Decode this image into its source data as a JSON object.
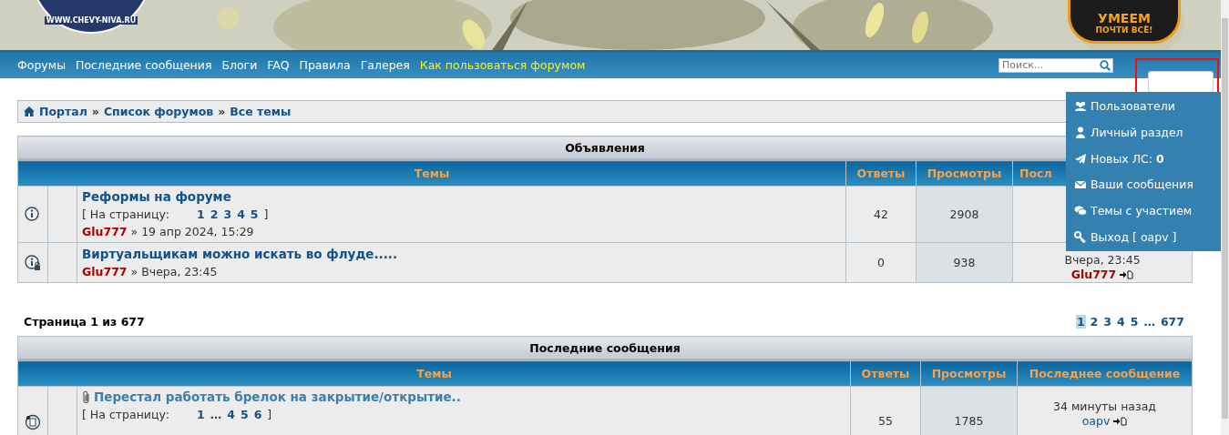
{
  "banner": {
    "logo_text": "WWW.CHEVY-NIVA.RU",
    "badge_lines": [
      "УМЕЕМ",
      "ПОЧТИ ВСЁ!"
    ]
  },
  "nav": {
    "links": [
      {
        "label": "Форумы",
        "highlighted": false
      },
      {
        "label": "Последние сообщения",
        "highlighted": false
      },
      {
        "label": "Блоги",
        "highlighted": false
      },
      {
        "label": "FAQ",
        "highlighted": false
      },
      {
        "label": "Правила",
        "highlighted": false
      },
      {
        "label": "Галерея",
        "highlighted": false
      },
      {
        "label": "Как пользоваться форумом",
        "highlighted": true
      }
    ],
    "search": {
      "placeholder": "Поиск..."
    }
  },
  "user_menu": {
    "items": [
      {
        "kind": "users",
        "label": "Пользователи"
      },
      {
        "kind": "profile",
        "label": "Личный раздел"
      },
      {
        "kind": "pm",
        "label": "Новых ЛС:",
        "count": "0"
      },
      {
        "kind": "posts",
        "label": "Ваши сообщения"
      },
      {
        "kind": "topics",
        "label": "Темы с участием"
      },
      {
        "kind": "logout",
        "label": "Выход [ oapv ]"
      }
    ]
  },
  "breadcrumbs": [
    {
      "label": "Портал"
    },
    {
      "separator": "»",
      "label": "Список форумов"
    },
    {
      "separator": "»",
      "label": "Все темы"
    }
  ],
  "announcements": {
    "title": "Объявления",
    "columns": [
      "Темы",
      "Ответы",
      "Просмотры",
      "Посл"
    ],
    "rows": [
      {
        "kind": "announce",
        "attachment": false,
        "title": "Реформы на форуме",
        "pages_label": "[ На страницу:",
        "pages": [
          "1",
          "2",
          "3",
          "4",
          "5"
        ],
        "pages_close": "]",
        "author": {
          "name": "Glu777",
          "kind": "admin"
        },
        "date": "» 19 апр 2024, 15:29",
        "replies": "42",
        "views": "2908"
      },
      {
        "kind": "announce_locked",
        "attachment": false,
        "title": "Виртуальщикам можно искать во флуде.....",
        "author": {
          "name": "Glu777",
          "kind": "admin"
        },
        "date": "» Вчера, 23:45",
        "replies": "0",
        "views": "938",
        "last_time": "Вчера, 23:45",
        "last_author": {
          "name": "Glu777",
          "kind": "admin"
        }
      }
    ]
  },
  "pagination": {
    "summary": "Страница 1 из 677",
    "pages": [
      {
        "label": "1",
        "selected": true
      },
      {
        "label": "2",
        "selected": false
      },
      {
        "label": "3",
        "selected": false
      },
      {
        "label": "4",
        "selected": false
      },
      {
        "label": "5",
        "selected": false
      },
      {
        "label": "…",
        "selected": false
      },
      {
        "label": "677",
        "selected": false
      }
    ]
  },
  "recent": {
    "title": "Последние сообщения",
    "columns": [
      "Темы",
      "Ответы",
      "Просмотры",
      "Последнее сообщение"
    ],
    "rows": [
      {
        "kind": "topic",
        "attachment": true,
        "title": "Перестал работать брелок на закрытие/открытие..",
        "pages_label": "[ На страницу:",
        "pages": [
          "1",
          "…",
          "4",
          "5",
          "6"
        ],
        "pages_close": "]",
        "replies": "55",
        "views": "1785",
        "last_time": "34 минуты назад",
        "last_author": {
          "name": "oapv",
          "kind": "user"
        }
      }
    ]
  }
}
